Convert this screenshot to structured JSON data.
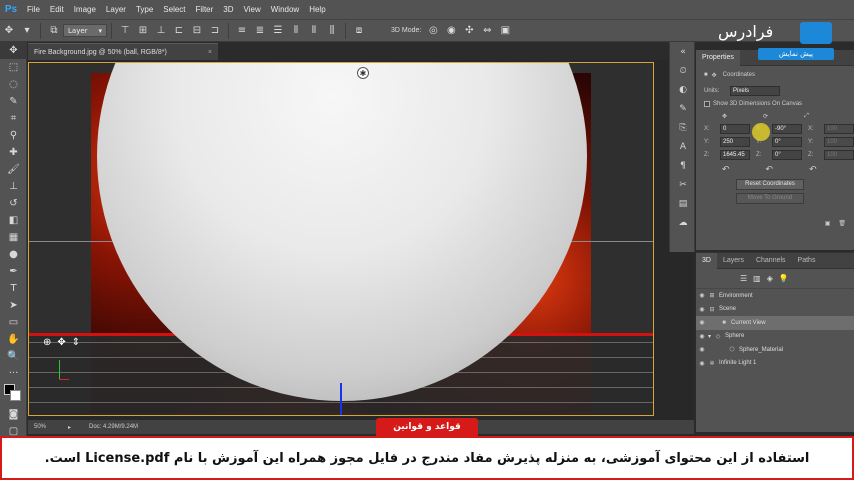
{
  "menu": {
    "logo": "Ps",
    "items": [
      "File",
      "Edit",
      "Image",
      "Layer",
      "Type",
      "Select",
      "Filter",
      "3D",
      "View",
      "Window",
      "Help"
    ]
  },
  "options": {
    "layer_dropdown": "Layer",
    "mode_label": "3D Mode:"
  },
  "document": {
    "tab_title": "Fire Background.jpg @ 50% (ball, RGB/8*)",
    "zoom": "50%",
    "doc_info": "Doc: 4.29M/9.24M"
  },
  "properties": {
    "tabs": [
      "Properties"
    ],
    "section_title": "Coordinates",
    "units_label": "Units:",
    "units_value": "Pixels",
    "show_dimensions": "Show 3D Dimensions On Canvas",
    "position": {
      "x_label": "X:",
      "x": "0",
      "y_label": "Y:",
      "y": "250",
      "z_label": "Z:",
      "z": "1645.45"
    },
    "rotation": {
      "x_label": "X:",
      "x": "-90°",
      "y_label": "Y:",
      "y": "0°",
      "z_label": "Z:",
      "z": "0°"
    },
    "scale": {
      "x_label": "X:",
      "x": "100",
      "y_label": "Y:",
      "y": "100",
      "z_label": "Z:",
      "z": "100"
    },
    "reset_button": "Reset Coordinates",
    "move_button": "Move To Ground"
  },
  "panel3d": {
    "tabs": [
      "3D",
      "Layers",
      "Channels",
      "Paths"
    ],
    "rows": [
      {
        "label": "Environment",
        "indent": 0
      },
      {
        "label": "Scene",
        "indent": 0
      },
      {
        "label": "Current View",
        "indent": 1
      },
      {
        "label": "Sphere",
        "indent": 1
      },
      {
        "label": "Sphere_Material",
        "indent": 2
      },
      {
        "label": "Infinite Light 1",
        "indent": 1
      }
    ]
  },
  "watermark": {
    "brand": "فرادرس",
    "preview": "پیش نمایش"
  },
  "rules": {
    "tag": "قواعد و قوانین",
    "license_text": "استفاده از این محتوای آموزشی، به منزله پذیرش مفاد مندرج در فایل مجوز همراه این آموزش با نام License.pdf است."
  },
  "colors": {
    "accent": "#31a8ff",
    "selection_frame": "#d7a43a",
    "rules_red": "#d61a1a",
    "axis_blue": "#1a32f0"
  }
}
